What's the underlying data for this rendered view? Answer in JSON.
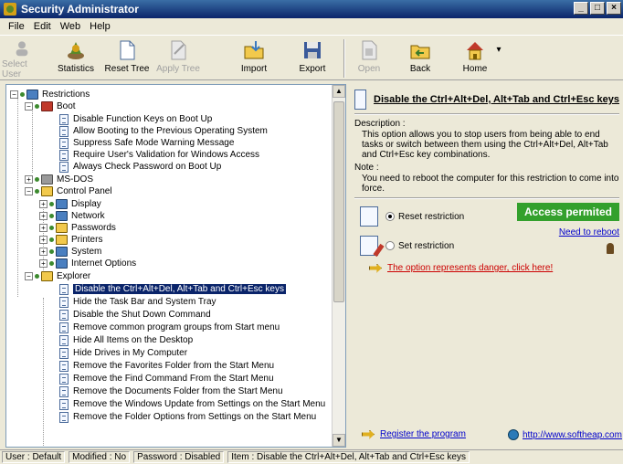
{
  "window": {
    "title": "Security Administrator",
    "minimize": "_",
    "maximize": "□",
    "close": "×"
  },
  "menu": [
    "File",
    "Edit",
    "Web",
    "Help"
  ],
  "toolbar": {
    "left": [
      {
        "label": "Select User",
        "enabled": false,
        "icon": "user-icon"
      },
      {
        "label": "Statistics",
        "enabled": true,
        "icon": "statistics-icon"
      },
      {
        "label": "Reset Tree",
        "enabled": true,
        "icon": "reset-tree-icon"
      },
      {
        "label": "Apply Tree",
        "enabled": false,
        "icon": "apply-tree-icon"
      },
      {
        "label": "Import",
        "enabled": true,
        "icon": "import-icon"
      },
      {
        "label": "Export",
        "enabled": true,
        "icon": "export-icon"
      }
    ],
    "right": [
      {
        "label": "Open",
        "enabled": false,
        "icon": "open-icon"
      },
      {
        "label": "Back",
        "enabled": true,
        "icon": "back-icon"
      },
      {
        "label": "Home",
        "enabled": true,
        "icon": "home-icon"
      }
    ],
    "dropdown": "▾"
  },
  "tree": {
    "root": "Restrictions",
    "boot": {
      "label": "Boot",
      "items": [
        "Disable Function Keys on Boot Up",
        "Allow Booting to the Previous Operating System",
        "Suppress Safe Mode Warning Message",
        "Require User's Validation for Windows Access",
        "Always Check Password on Boot Up"
      ]
    },
    "msdos": "MS-DOS",
    "control_panel": {
      "label": "Control Panel",
      "items": [
        "Display",
        "Network",
        "Passwords",
        "Printers",
        "System",
        "Internet Options"
      ]
    },
    "explorer": {
      "label": "Explorer",
      "items": [
        "Disable the Ctrl+Alt+Del, Alt+Tab and Ctrl+Esc keys",
        "Hide the Task Bar and System Tray",
        "Disable the Shut Down Command",
        "Remove common program groups from Start menu",
        "Hide All Items on the Desktop",
        "Hide Drives in My Computer",
        "Remove the Favorites Folder from the Start Menu",
        "Remove the Find Command From the Start Menu",
        "Remove the Documents Folder from the Start Menu",
        "Remove the Windows Update from Settings on the Start Menu",
        "Remove the Folder Options from Settings on the Start Menu"
      ]
    },
    "expand_plus": "+",
    "expand_minus": "−",
    "scroll_up": "▲",
    "scroll_down": "▼"
  },
  "detail": {
    "title": "Disable the Ctrl+Alt+Del, Alt+Tab and Ctrl+Esc keys",
    "description_label": "Description :",
    "description": "This option allows you to stop users from being able to end tasks or switch between them using the Ctrl+Alt+Del, Alt+Tab and Ctrl+Esc key combinations.",
    "note_label": "Note :",
    "note": "You need to reboot the computer for this restriction to come into force.",
    "reset_label": "Reset restriction",
    "set_label": "Set restriction",
    "status_badge": "Access permited",
    "reboot_link": "Need to reboot",
    "danger_link": "The option represents danger, click here!",
    "register_link": "Register the program",
    "website_link": "http://www.softheap.com",
    "badge_color": "#33a02c"
  },
  "status": {
    "user": "User : Default",
    "modified": "Modified : No",
    "password": "Password : Disabled",
    "item": "Item : Disable the Ctrl+Alt+Del, Alt+Tab and Ctrl+Esc keys"
  }
}
